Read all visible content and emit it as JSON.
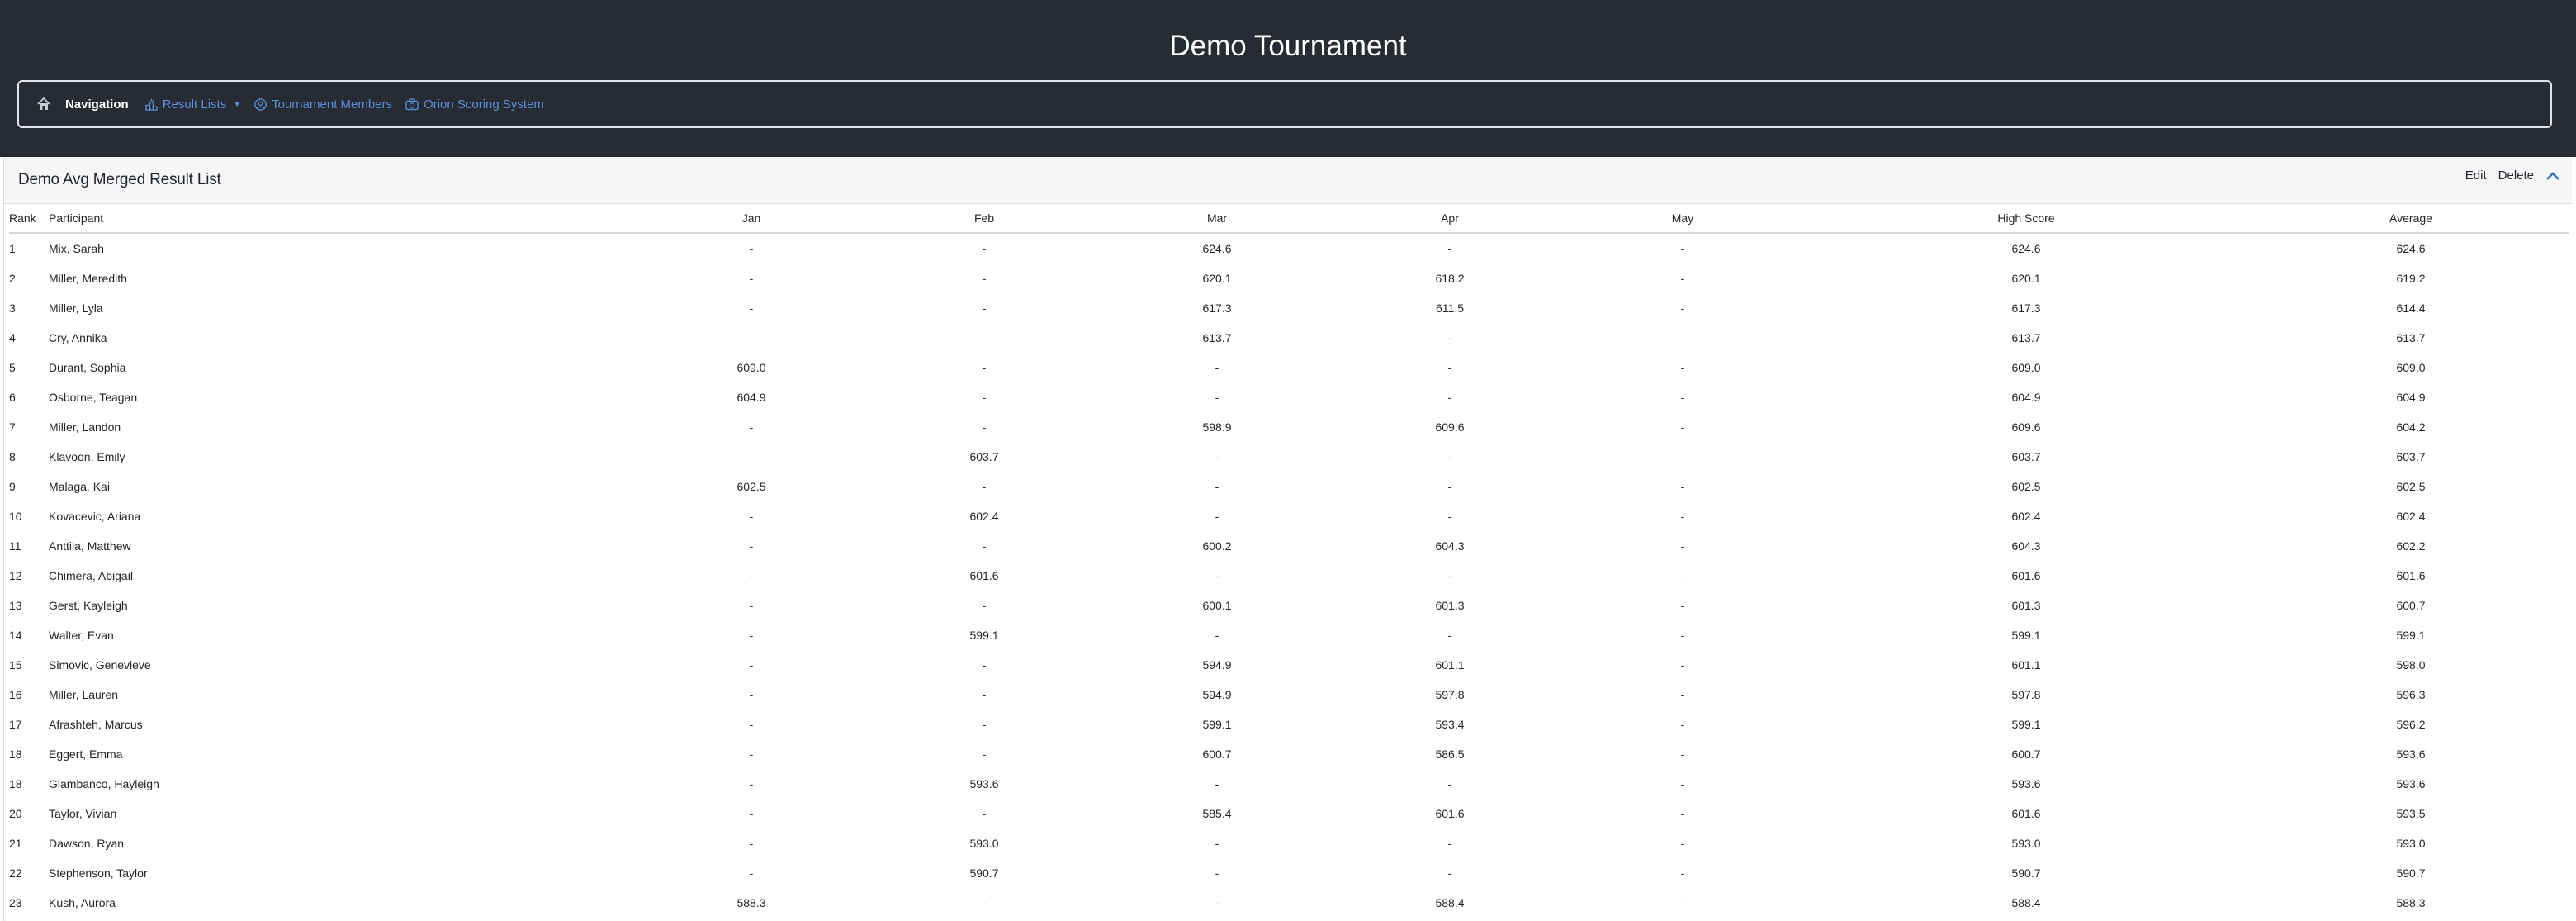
{
  "page_title": "Demo Tournament",
  "nav": {
    "brand": "Navigation",
    "links": [
      {
        "label": "Result Lists",
        "icon": "podium-icon",
        "dropdown": true
      },
      {
        "label": "Tournament Members",
        "icon": "user-circle-icon",
        "dropdown": false
      },
      {
        "label": "Orion Scoring System",
        "icon": "camera-icon",
        "dropdown": false
      }
    ]
  },
  "panel": {
    "title": "Demo Avg Merged Result List",
    "edit_label": "Edit",
    "delete_label": "Delete"
  },
  "table": {
    "headers": [
      "Rank",
      "Participant",
      "Jan",
      "Feb",
      "Mar",
      "Apr",
      "May",
      "High Score",
      "Average"
    ],
    "rows": [
      [
        "1",
        "Mix, Sarah",
        "-",
        "-",
        "624.6",
        "-",
        "-",
        "624.6",
        "624.6"
      ],
      [
        "2",
        "Miller, Meredith",
        "-",
        "-",
        "620.1",
        "618.2",
        "-",
        "620.1",
        "619.2"
      ],
      [
        "3",
        "Miller, Lyla",
        "-",
        "-",
        "617.3",
        "611.5",
        "-",
        "617.3",
        "614.4"
      ],
      [
        "4",
        "Cry, Annika",
        "-",
        "-",
        "613.7",
        "-",
        "-",
        "613.7",
        "613.7"
      ],
      [
        "5",
        "Durant, Sophia",
        "609.0",
        "-",
        "-",
        "-",
        "-",
        "609.0",
        "609.0"
      ],
      [
        "6",
        "Osborne, Teagan",
        "604.9",
        "-",
        "-",
        "-",
        "-",
        "604.9",
        "604.9"
      ],
      [
        "7",
        "Miller, Landon",
        "-",
        "-",
        "598.9",
        "609.6",
        "-",
        "609.6",
        "604.2"
      ],
      [
        "8",
        "Klavoon, Emily",
        "-",
        "603.7",
        "-",
        "-",
        "-",
        "603.7",
        "603.7"
      ],
      [
        "9",
        "Malaga, Kai",
        "602.5",
        "-",
        "-",
        "-",
        "-",
        "602.5",
        "602.5"
      ],
      [
        "10",
        "Kovacevic, Ariana",
        "-",
        "602.4",
        "-",
        "-",
        "-",
        "602.4",
        "602.4"
      ],
      [
        "11",
        "Anttila, Matthew",
        "-",
        "-",
        "600.2",
        "604.3",
        "-",
        "604.3",
        "602.2"
      ],
      [
        "12",
        "Chimera, Abigail",
        "-",
        "601.6",
        "-",
        "-",
        "-",
        "601.6",
        "601.6"
      ],
      [
        "13",
        "Gerst, Kayleigh",
        "-",
        "-",
        "600.1",
        "601.3",
        "-",
        "601.3",
        "600.7"
      ],
      [
        "14",
        "Walter, Evan",
        "-",
        "599.1",
        "-",
        "-",
        "-",
        "599.1",
        "599.1"
      ],
      [
        "15",
        "Simovic, Genevieve",
        "-",
        "-",
        "594.9",
        "601.1",
        "-",
        "601.1",
        "598.0"
      ],
      [
        "16",
        "Miller, Lauren",
        "-",
        "-",
        "594.9",
        "597.8",
        "-",
        "597.8",
        "596.3"
      ],
      [
        "17",
        "Afrashteh, Marcus",
        "-",
        "-",
        "599.1",
        "593.4",
        "-",
        "599.1",
        "596.2"
      ],
      [
        "18",
        "Eggert, Emma",
        "-",
        "-",
        "600.7",
        "586.5",
        "-",
        "600.7",
        "593.6"
      ],
      [
        "18",
        "Glambanco, Hayleigh",
        "-",
        "593.6",
        "-",
        "-",
        "-",
        "593.6",
        "593.6"
      ],
      [
        "20",
        "Taylor, Vivian",
        "-",
        "-",
        "585.4",
        "601.6",
        "-",
        "601.6",
        "593.5"
      ],
      [
        "21",
        "Dawson, Ryan",
        "-",
        "593.0",
        "-",
        "-",
        "-",
        "593.0",
        "593.0"
      ],
      [
        "22",
        "Stephenson, Taylor",
        "-",
        "590.7",
        "-",
        "-",
        "-",
        "590.7",
        "590.7"
      ],
      [
        "23",
        "Kush, Aurora",
        "588.3",
        "-",
        "-",
        "588.4",
        "-",
        "588.4",
        "588.3"
      ]
    ]
  }
}
